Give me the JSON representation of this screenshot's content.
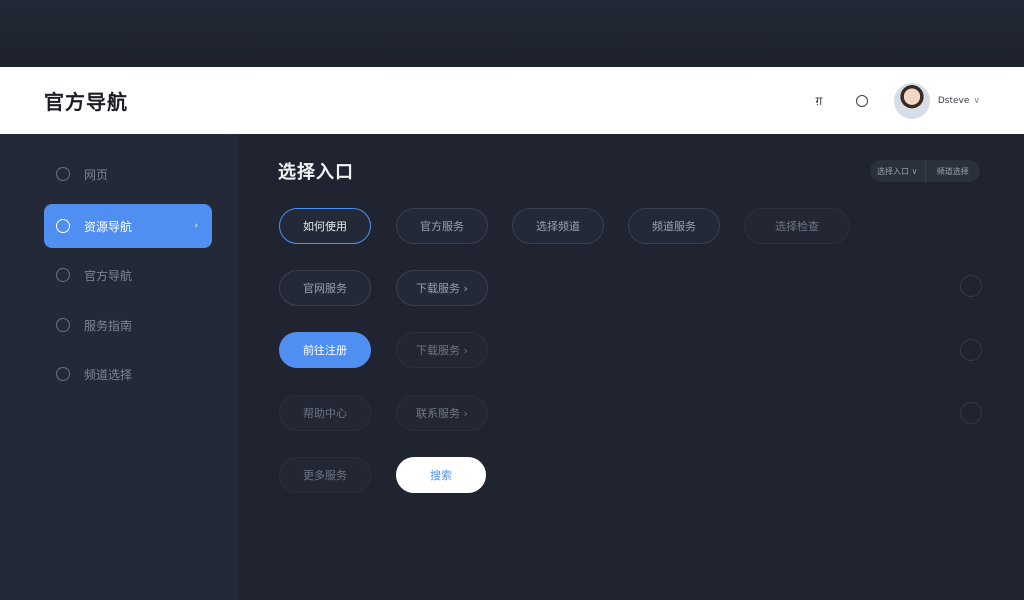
{
  "header": {
    "brand": "官方导航",
    "lang_icon_label": "ग़",
    "username": "Dsteve"
  },
  "sidebar": {
    "items": [
      {
        "label": "网页",
        "active": false
      },
      {
        "label": "资源导航",
        "active": true
      },
      {
        "label": "官方导航",
        "active": false
      },
      {
        "label": "服务指南",
        "active": false
      },
      {
        "label": "频道选择",
        "active": false
      }
    ]
  },
  "main": {
    "title": "选择入口",
    "filter": {
      "left": "选择入口 ∨",
      "right": "频道选择"
    },
    "rows": [
      [
        "如何使用",
        "官方服务",
        "选择频道",
        "频道服务",
        "选择检查"
      ],
      [
        "官网服务",
        "下载服务 ›"
      ],
      [
        "前往注册",
        "下载服务 ›"
      ],
      [
        "帮助中心",
        "联系服务 ›"
      ],
      [
        "更多服务",
        "搜索"
      ]
    ]
  },
  "colors": {
    "accent": "#4f8ff2",
    "background": "#1f2430",
    "sidebar": "#232936",
    "header": "#ffffff"
  }
}
